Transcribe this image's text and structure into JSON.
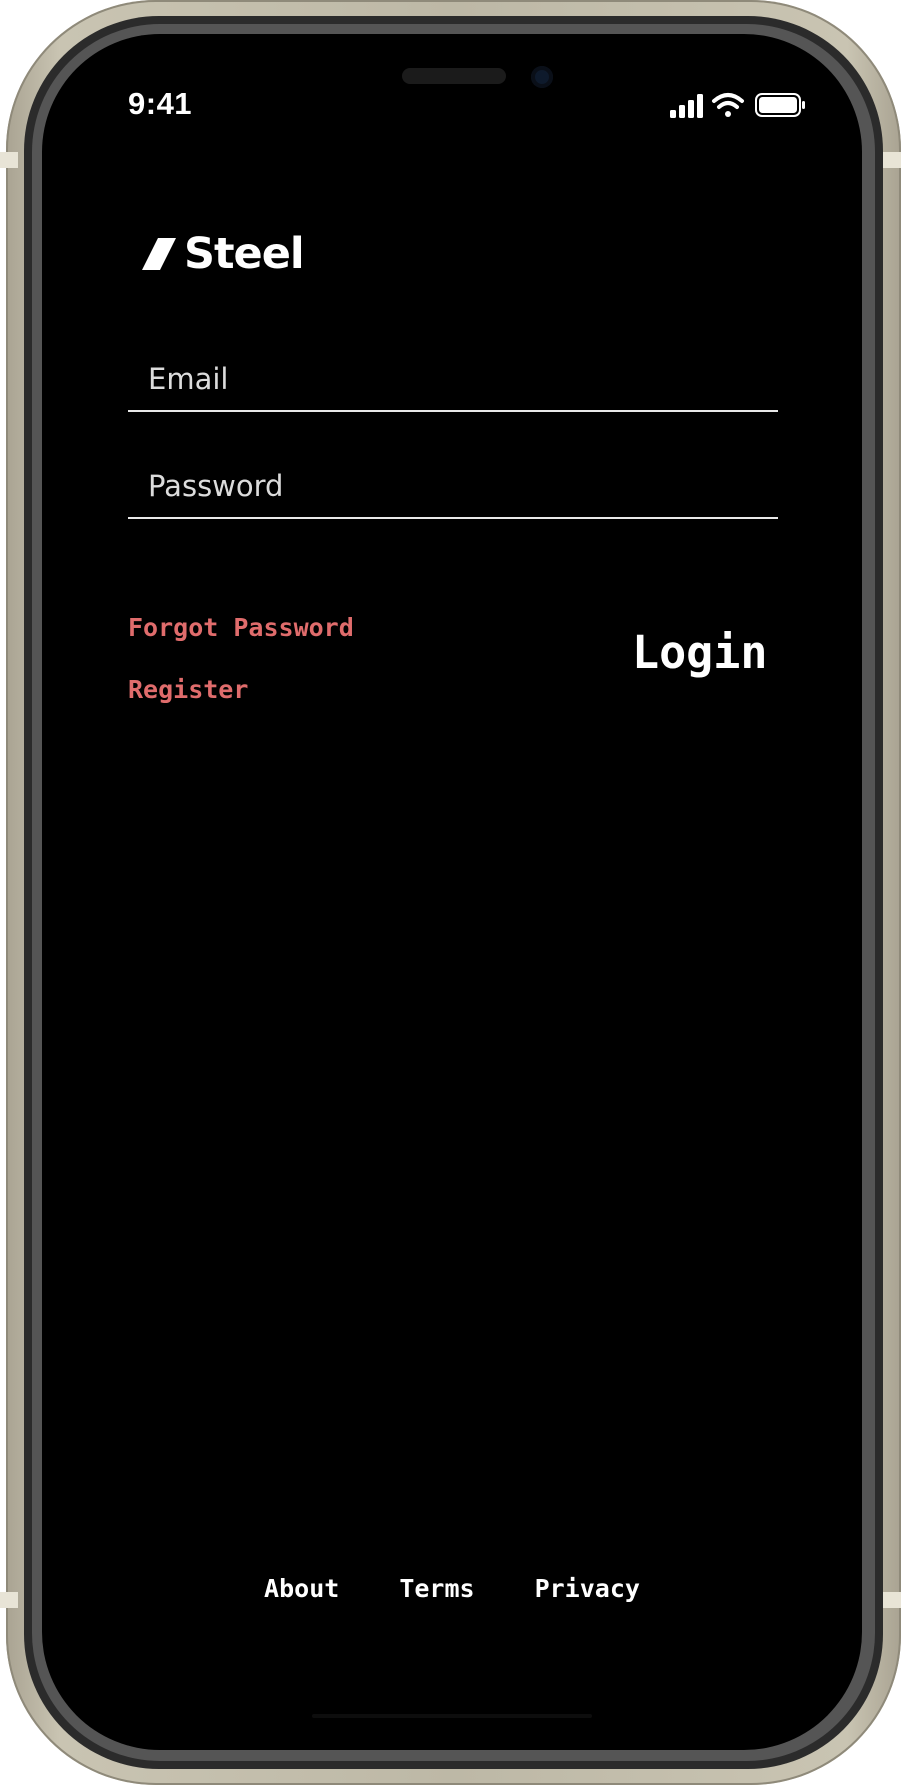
{
  "status_bar": {
    "time": "9:41",
    "icons": [
      "cellular-signal-icon",
      "wifi-icon",
      "battery-icon"
    ]
  },
  "brand": {
    "name": "Steel",
    "logo_icon": "slash-logo-icon"
  },
  "form": {
    "email_placeholder": "Email",
    "email_value": "",
    "password_placeholder": "Password",
    "password_value": ""
  },
  "actions": {
    "forgot_password": "Forgot Password",
    "register": "Register",
    "login": "Login"
  },
  "footer": {
    "links": [
      "About",
      "Terms",
      "Privacy"
    ]
  },
  "colors": {
    "background": "#000000",
    "accent_link": "#e06c6c",
    "text": "#ffffff",
    "device_frame": "#bdb8a6"
  }
}
